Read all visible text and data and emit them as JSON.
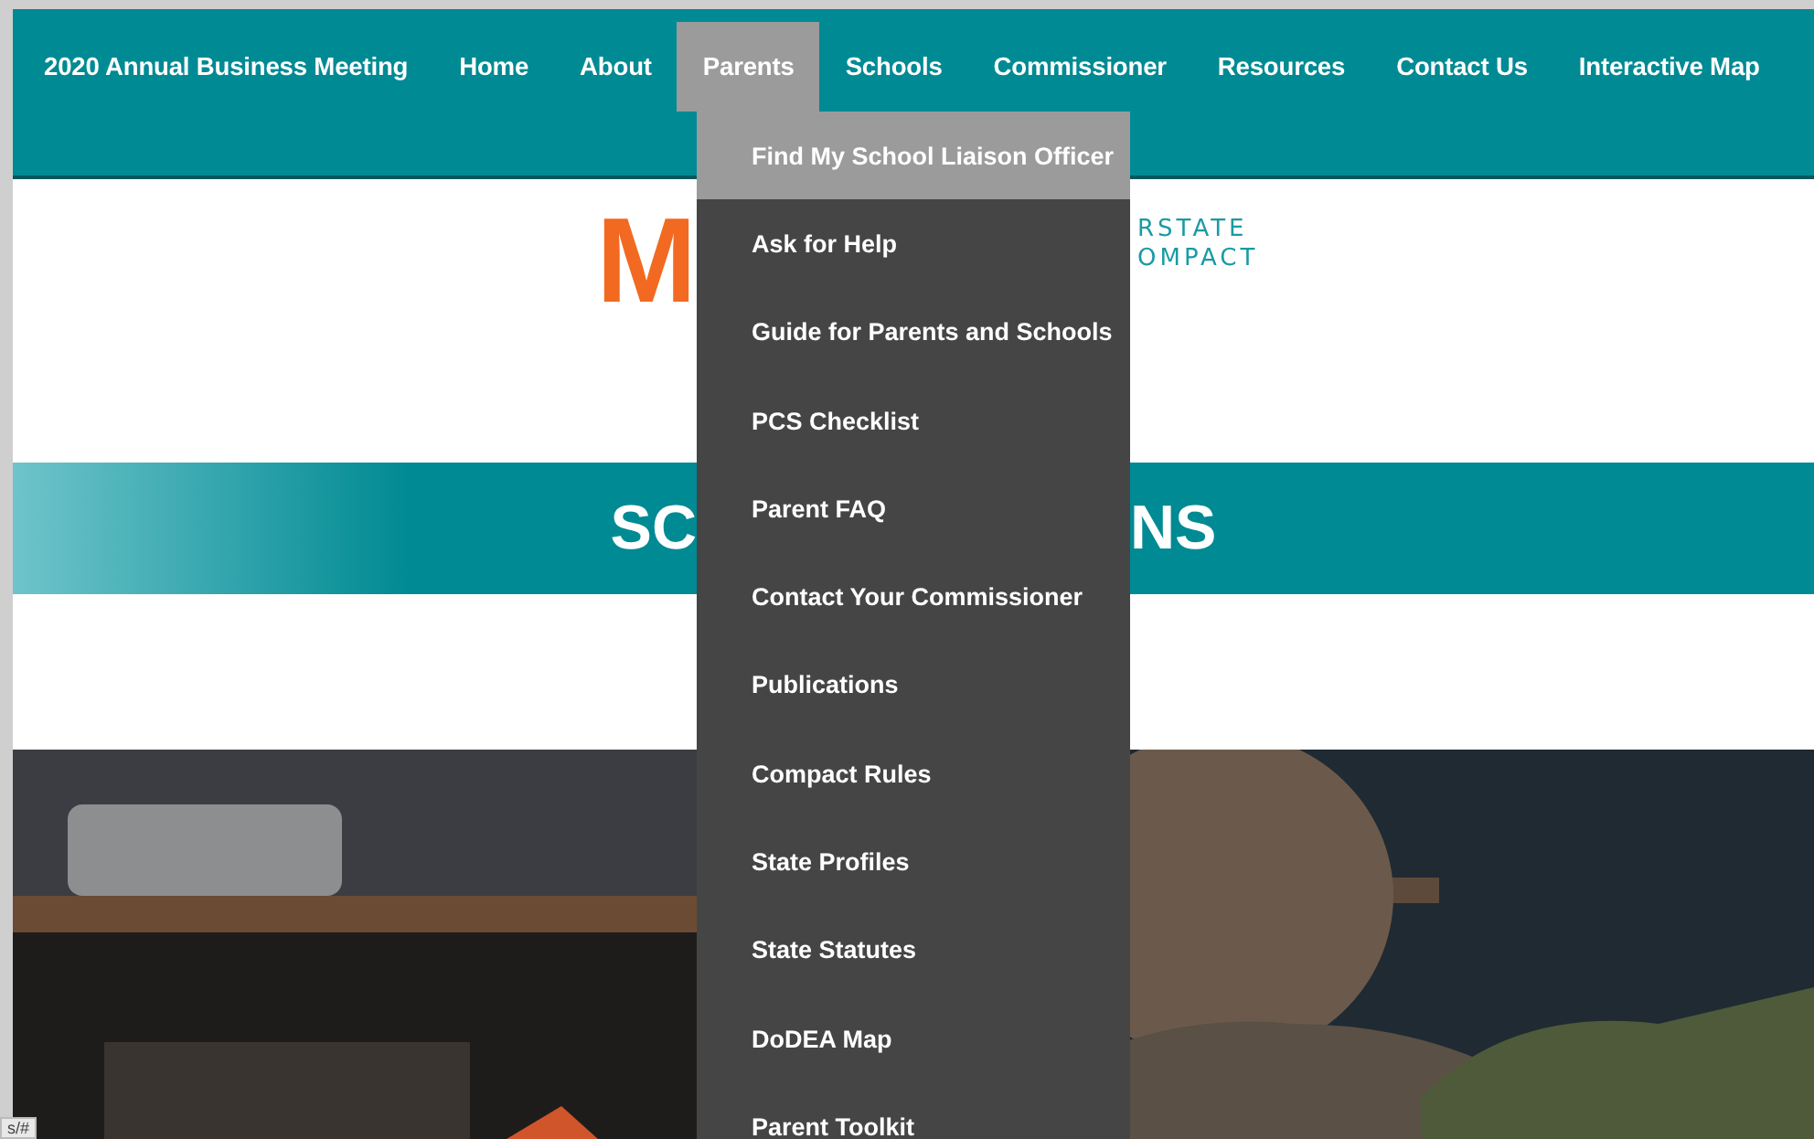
{
  "nav": [
    {
      "label": "2020 Annual Business Meeting",
      "selected": false
    },
    {
      "label": "Home",
      "selected": false
    },
    {
      "label": "About",
      "selected": false
    },
    {
      "label": "Parents",
      "selected": true
    },
    {
      "label": "Schools",
      "selected": false
    },
    {
      "label": "Commissioner",
      "selected": false
    },
    {
      "label": "Resources",
      "selected": false
    },
    {
      "label": "Contact Us",
      "selected": false
    },
    {
      "label": "Interactive Map",
      "selected": false
    }
  ],
  "dropdown": [
    {
      "label": "Find My School Liaison Officer",
      "selected": true
    },
    {
      "label": "Ask for Help",
      "selected": false
    },
    {
      "label": "Guide for Parents and Schools",
      "selected": false
    },
    {
      "label": "PCS Checklist",
      "selected": false
    },
    {
      "label": "Parent FAQ",
      "selected": false
    },
    {
      "label": "Contact Your Commissioner",
      "selected": false
    },
    {
      "label": "Publications",
      "selected": false
    },
    {
      "label": "Compact Rules",
      "selected": false
    },
    {
      "label": "State Profiles",
      "selected": false
    },
    {
      "label": "State Statutes",
      "selected": false
    },
    {
      "label": "DoDEA Map",
      "selected": false
    },
    {
      "label": "Parent Toolkit",
      "selected": false
    }
  ],
  "logo": {
    "mark": "M",
    "line_1": "RSTATE",
    "line_2": "OMPACT"
  },
  "banner": {
    "left": "SC",
    "right": "NS"
  },
  "status_url": "s/#"
}
